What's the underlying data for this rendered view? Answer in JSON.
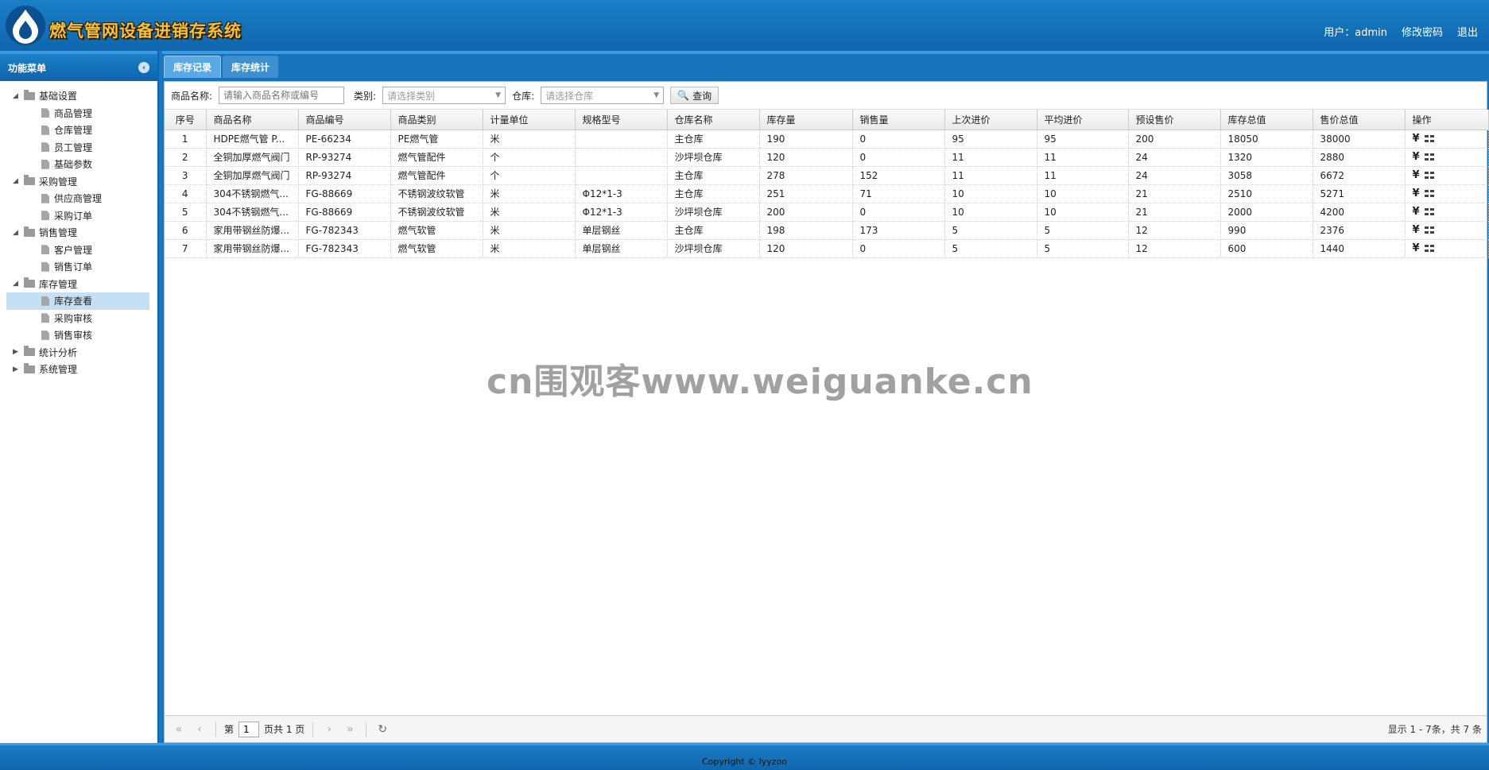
{
  "header": {
    "app_title": "燃气管网设备进销存系统",
    "user_label": "用户：admin",
    "change_password": "修改密码",
    "logout": "退出"
  },
  "sidebar": {
    "title": "功能菜单",
    "collapse_icon": "chevron-left-circle-icon",
    "groups": [
      {
        "label": "基础设置",
        "expanded": true,
        "items": [
          "商品管理",
          "仓库管理",
          "员工管理",
          "基础参数"
        ]
      },
      {
        "label": "采购管理",
        "expanded": true,
        "items": [
          "供应商管理",
          "采购订单"
        ]
      },
      {
        "label": "销售管理",
        "expanded": true,
        "items": [
          "客户管理",
          "销售订单"
        ]
      },
      {
        "label": "库存管理",
        "expanded": true,
        "items": [
          "库存查看",
          "采购审核",
          "销售审核"
        ],
        "selected": "库存查看"
      },
      {
        "label": "统计分析",
        "expanded": false,
        "items": []
      },
      {
        "label": "系统管理",
        "expanded": false,
        "items": []
      }
    ]
  },
  "tabs": [
    {
      "label": "库存记录",
      "active": true
    },
    {
      "label": "库存统计",
      "active": false
    }
  ],
  "toolbar": {
    "name_label": "商品名称:",
    "name_placeholder": "请输入商品名称或编号",
    "category_label": "类别:",
    "category_placeholder": "请选择类别",
    "warehouse_label": "仓库:",
    "warehouse_placeholder": "请选择仓库",
    "search_button": "查询"
  },
  "table": {
    "columns": [
      "序号",
      "商品名称",
      "商品编号",
      "商品类别",
      "计量单位",
      "规格型号",
      "仓库名称",
      "库存量",
      "销售量",
      "上次进价",
      "平均进价",
      "预设售价",
      "库存总值",
      "售价总值",
      "操作"
    ],
    "rows": [
      [
        "1",
        "HDPE燃气管 P...",
        "PE-66234",
        "PE燃气管",
        "米",
        "",
        "主仓库",
        "190",
        "0",
        "95",
        "95",
        "200",
        "18050",
        "38000"
      ],
      [
        "2",
        "全铜加厚燃气阀门",
        "RP-93274",
        "燃气管配件",
        "个",
        "",
        "沙坪坝仓库",
        "120",
        "0",
        "11",
        "11",
        "24",
        "1320",
        "2880"
      ],
      [
        "3",
        "全铜加厚燃气阀门",
        "RP-93274",
        "燃气管配件",
        "个",
        "",
        "主仓库",
        "278",
        "152",
        "11",
        "11",
        "24",
        "3058",
        "6672"
      ],
      [
        "4",
        "304不锈钢燃气...",
        "FG-88669",
        "不锈钢波纹软管",
        "米",
        "Φ12*1-3",
        "主仓库",
        "251",
        "71",
        "10",
        "10",
        "21",
        "2510",
        "5271"
      ],
      [
        "5",
        "304不锈钢燃气...",
        "FG-88669",
        "不锈钢波纹软管",
        "米",
        "Φ12*1-3",
        "沙坪坝仓库",
        "200",
        "0",
        "10",
        "10",
        "21",
        "2000",
        "4200"
      ],
      [
        "6",
        "家用带钢丝防爆...",
        "FG-782343",
        "燃气软管",
        "米",
        "单层钢丝",
        "主仓库",
        "198",
        "173",
        "5",
        "5",
        "12",
        "990",
        "2376"
      ],
      [
        "7",
        "家用带钢丝防爆...",
        "FG-782343",
        "燃气软管",
        "米",
        "单层钢丝",
        "沙坪坝仓库",
        "120",
        "0",
        "5",
        "5",
        "12",
        "600",
        "1440"
      ]
    ],
    "op_icons": [
      "yen-icon",
      "tree-structure-icon"
    ],
    "op_yen": "¥"
  },
  "pager": {
    "page_prefix": "第",
    "page_value": "1",
    "page_suffix": "页共 1 页",
    "info": "显示 1 - 7条，共 7 条"
  },
  "watermark": "cn围观客www.weiguanke.cn",
  "footer": "Copyright © lyyzoo",
  "colors": {
    "header": "#1a7fc7",
    "selected": "#c5e0f5",
    "title": "#f5c03a"
  }
}
